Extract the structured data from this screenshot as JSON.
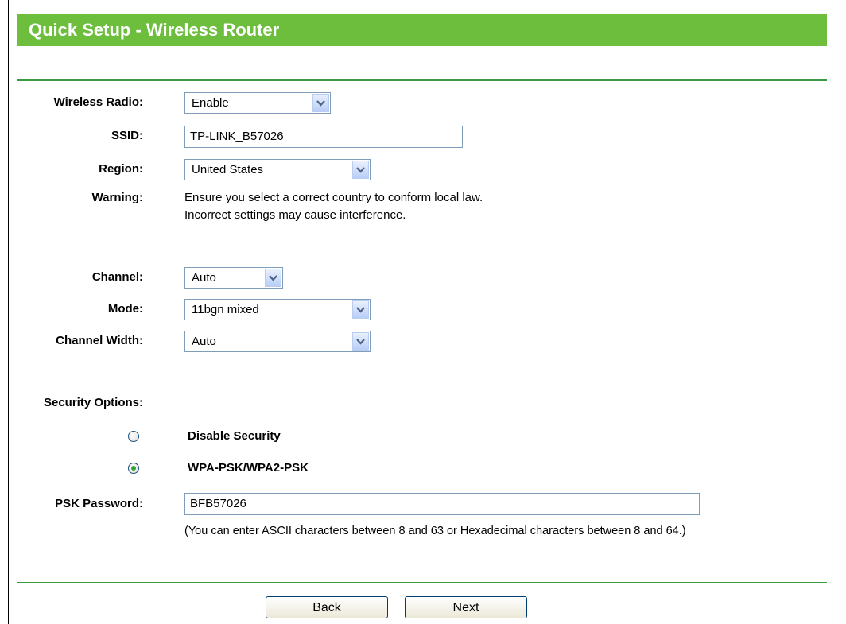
{
  "page": {
    "title": "Quick Setup - Wireless Router",
    "accent_color": "#6cbe3c",
    "divider_color": "#3a9a3f"
  },
  "wireless_radio": {
    "label": "Wireless Radio:",
    "value": "Enable"
  },
  "ssid": {
    "label": "SSID:",
    "value": "TP-LINK_B57026"
  },
  "region": {
    "label": "Region:",
    "value": "United States"
  },
  "warning": {
    "label": "Warning:",
    "line1": "Ensure you select a correct country to conform local law.",
    "line2": "Incorrect settings may cause interference."
  },
  "channel": {
    "label": "Channel:",
    "value": "Auto"
  },
  "mode": {
    "label": "Mode:",
    "value": "11bgn mixed"
  },
  "channel_width": {
    "label": "Channel Width:",
    "value": "Auto"
  },
  "security": {
    "label": "Security Options:",
    "options": [
      {
        "label": "Disable Security",
        "selected": false
      },
      {
        "label": "WPA-PSK/WPA2-PSK",
        "selected": true
      }
    ]
  },
  "psk": {
    "label": "PSK Password:",
    "value": "BFB57026",
    "hint": "(You can enter ASCII characters between 8 and 63 or Hexadecimal characters between 8 and 64.)"
  },
  "buttons": {
    "back": "Back",
    "next": "Next"
  },
  "icons": {
    "dropdown": "chevron-down-icon",
    "radio": "radio-icon"
  }
}
